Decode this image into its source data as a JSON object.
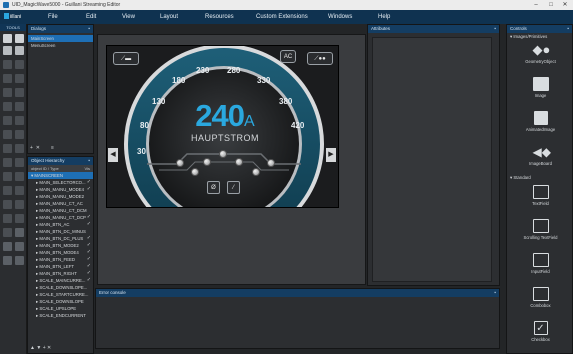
{
  "window": {
    "title": "UID_MagicWave5000 - Guillani Streaming Editor",
    "minimize": "–",
    "maximize": "□",
    "close": "✕"
  },
  "app": {
    "logo_text": "iillani"
  },
  "menu": [
    "File",
    "Edit",
    "View",
    "Layout",
    "Resources",
    "Custom Extensions",
    "Windows",
    "Help"
  ],
  "tools": {
    "title": "TOOLS"
  },
  "dialogs": {
    "title": "Dialogs",
    "items": [
      "MainScreen",
      "MenuScreen"
    ],
    "selected": 0
  },
  "hierarchy": {
    "title": "Object Hierarchy",
    "columns": [
      "object ID / Type",
      "Vis"
    ],
    "items": [
      {
        "label": "MAINSCREEN",
        "check": false
      },
      {
        "label": "MAIN_SELECTORCO...",
        "check": true
      },
      {
        "label": "MAIN_MAINU_MODE4",
        "check": true
      },
      {
        "label": "MAIN_MAINU_MODE2",
        "check": false
      },
      {
        "label": "MAIN_MAINU_CT_AC",
        "check": false
      },
      {
        "label": "MAIN_MAINU_CT_DCM",
        "check": false
      },
      {
        "label": "MAIN_MAINU_CT_DCP",
        "check": true
      },
      {
        "label": "MAIN_BTN_AC",
        "check": true
      },
      {
        "label": "MAIN_BTN_DC_MINUS",
        "check": false
      },
      {
        "label": "MAIN_BTN_DC_PLUS",
        "check": true
      },
      {
        "label": "MAIN_BTN_MODE2",
        "check": true
      },
      {
        "label": "MAIN_BTN_MODE4",
        "check": true
      },
      {
        "label": "MAIN_BTN_FEED",
        "check": true
      },
      {
        "label": "MAIN_BTN_LEFT",
        "check": true
      },
      {
        "label": "MAIN_BTN_RIGHT",
        "check": true
      },
      {
        "label": "SCALE_MAINCURRE...",
        "check": true
      },
      {
        "label": "SCALE_DOWNSLOPE...",
        "check": false
      },
      {
        "label": "SCALE_STARTCURRE...",
        "check": false
      },
      {
        "label": "SCALE_DOWNSLOPE",
        "check": false
      },
      {
        "label": "SCALE_UPSLOPE",
        "check": false
      },
      {
        "label": "SCALE_ENDCURRENT",
        "check": false
      }
    ]
  },
  "canvas": {
    "value": "240",
    "unit": "A",
    "label": "HAUPTSTROM",
    "ticks": [
      "30",
      "80",
      "130",
      "180",
      "230",
      "280",
      "330",
      "380",
      "420"
    ],
    "ac_label": "AC",
    "diameter": "Ø",
    "slash": "⁄"
  },
  "attributes": {
    "title": "Attributes"
  },
  "errors": {
    "title": "Error console"
  },
  "controls": {
    "title": "Controls",
    "groups": [
      "Images/Primitives",
      "Standard"
    ],
    "items": [
      "GeometryObject",
      "Image",
      "AnimatedImage",
      "ImageBoard",
      "TextField",
      "Scrolling TextField",
      "InputField",
      "Combobox",
      "Checkbox"
    ]
  }
}
